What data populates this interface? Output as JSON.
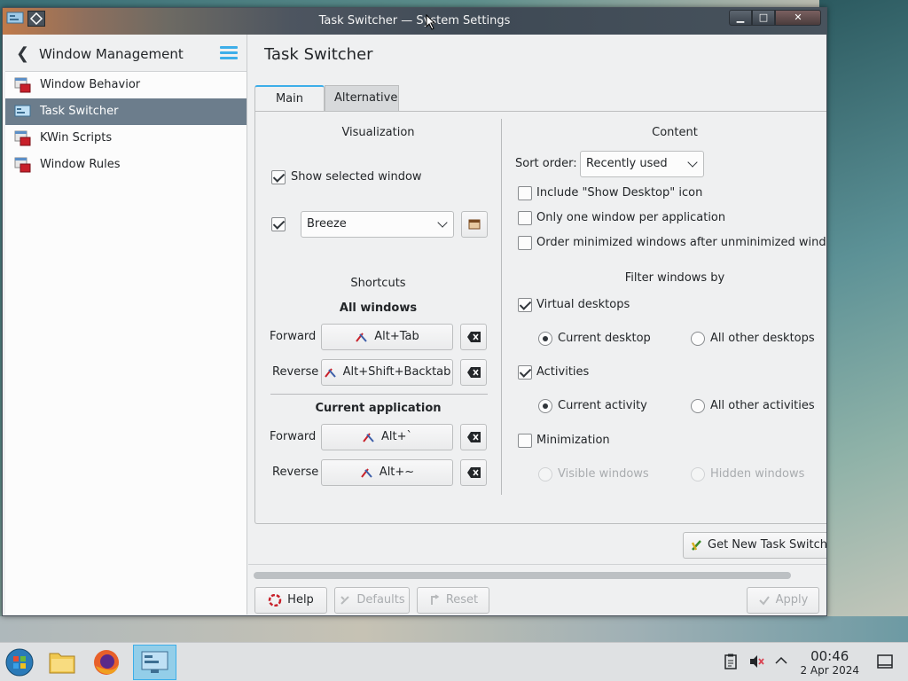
{
  "window": {
    "title": "Task Switcher — System Settings",
    "buttons": {
      "minimize": "▁",
      "maximize": "□",
      "close": "✕"
    }
  },
  "sidebar": {
    "header": "Window Management",
    "items": [
      {
        "label": "Window Behavior"
      },
      {
        "label": "Task Switcher"
      },
      {
        "label": "KWin Scripts"
      },
      {
        "label": "Window Rules"
      }
    ]
  },
  "main": {
    "title": "Task Switcher",
    "tabs": [
      {
        "label": "Main"
      },
      {
        "label": "Alternative"
      }
    ],
    "visualization": {
      "title": "Visualization",
      "show_selected_window": "Show selected window",
      "theme": "Breeze"
    },
    "shortcuts": {
      "title": "Shortcuts",
      "all_windows": "All windows",
      "forward": "Forward",
      "reverse": "Reverse",
      "all_forward_key": "Alt+Tab",
      "all_reverse_key": "Alt+Shift+Backtab",
      "current_application": "Current application",
      "cur_forward_key": "Alt+`",
      "cur_reverse_key": "Alt+~"
    },
    "content": {
      "title": "Content",
      "sort_order_label": "Sort order:",
      "sort_order_value": "Recently used",
      "include_show_desktop": "Include \"Show Desktop\" icon",
      "one_window_per_app": "Only one window per application",
      "order_minimized": "Order minimized windows after unminimized windows",
      "filter_title": "Filter windows by",
      "virtual_desktops": "Virtual desktops",
      "current_desktop": "Current desktop",
      "all_other_desktops": "All other desktops",
      "activities": "Activities",
      "current_activity": "Current activity",
      "all_other_activities": "All other activities",
      "minimization": "Minimization",
      "visible_windows": "Visible windows",
      "hidden_windows": "Hidden windows"
    },
    "get_new": "Get New Task Switchers...",
    "footer": {
      "help": "Help",
      "defaults": "Defaults",
      "reset": "Reset",
      "apply": "Apply"
    }
  },
  "taskbar": {
    "time": "00:46",
    "date": "2 Apr 2024"
  },
  "colors": {
    "accent": "#3daee9",
    "selection": "#6c7d8c"
  }
}
